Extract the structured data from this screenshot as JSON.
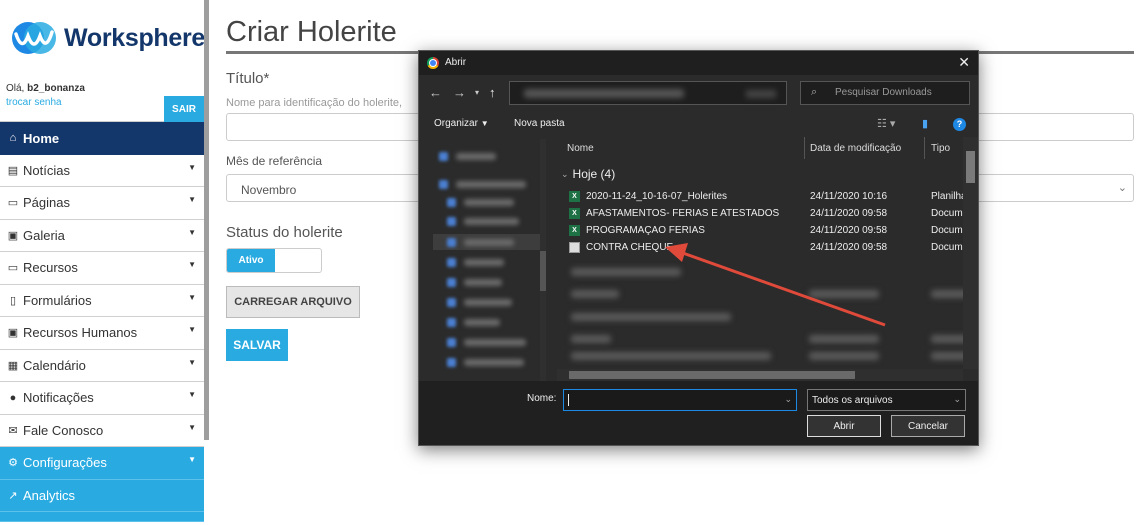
{
  "sidebar": {
    "logo_text": "Worksphere",
    "greeting": "Olá, ",
    "username": "b2_bonanza",
    "change_password": "trocar senha",
    "logout": "SAIR",
    "items": [
      {
        "label": "Home",
        "icon": "home-icon"
      },
      {
        "label": "Notícias",
        "icon": "newspaper-icon"
      },
      {
        "label": "Páginas",
        "icon": "window-icon"
      },
      {
        "label": "Galeria",
        "icon": "image-icon"
      },
      {
        "label": "Recursos",
        "icon": "laptop-icon"
      },
      {
        "label": "Formulários",
        "icon": "file-icon"
      },
      {
        "label": "Recursos Humanos",
        "icon": "id-badge-icon"
      },
      {
        "label": "Calendário",
        "icon": "calendar-icon"
      },
      {
        "label": "Notificações",
        "icon": "info-icon"
      },
      {
        "label": "Fale Conosco",
        "icon": "envelope-icon"
      },
      {
        "label": "Configurações",
        "icon": "gear-icon"
      },
      {
        "label": "Analytics",
        "icon": "chart-icon"
      }
    ]
  },
  "form": {
    "page_title": "Criar Holerite",
    "title_label": "Título*",
    "title_hint": "Nome para identificação do holerite,",
    "title_value": "",
    "month_label": "Mês de referência",
    "month_value": "Novembro",
    "status_label": "Status do holerite",
    "status_value": "Ativo",
    "upload_button": "CARREGAR ARQUIVO",
    "save_button": "SALVAR"
  },
  "dialog": {
    "title": "Abrir",
    "close": "✕",
    "search_placeholder": "Pesquisar Downloads",
    "organize": "Organizar",
    "new_folder": "Nova pasta",
    "columns": {
      "name": "Nome",
      "date": "Data de modificação",
      "type": "Tipo"
    },
    "group_label": "Hoje (4)",
    "files": [
      {
        "name": "2020-11-24_10-16-07_Holerites",
        "date": "24/11/2020 10:16",
        "type": "Planilha",
        "icon": "excel-icon"
      },
      {
        "name": "AFASTAMENTOS- FERIAS E ATESTADOS",
        "date": "24/11/2020 09:58",
        "type": "Docum",
        "icon": "excel-icon"
      },
      {
        "name": "PROGRAMAÇAO FERIAS",
        "date": "24/11/2020 09:58",
        "type": "Docum",
        "icon": "excel-icon"
      },
      {
        "name": "CONTRA CHEQUE",
        "date": "24/11/2020 09:58",
        "type": "Docum",
        "icon": "document-icon"
      }
    ],
    "filename_label": "Nome:",
    "filename_value": "",
    "filetype_value": "Todos os arquivos",
    "open_button": "Abrir",
    "cancel_button": "Cancelar"
  },
  "colors": {
    "navy": "#13366b",
    "accent": "#29abe2",
    "arrow": "#e04a3a"
  }
}
